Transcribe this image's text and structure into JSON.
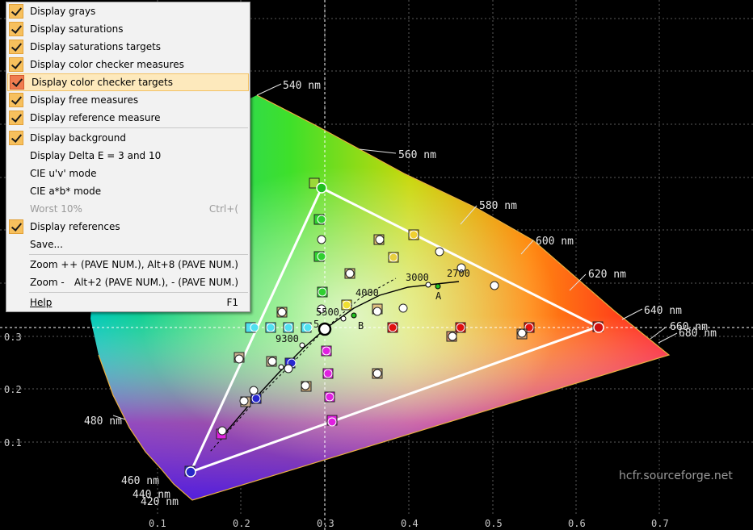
{
  "menu": {
    "items": [
      {
        "label": "Display grays",
        "checked": true,
        "selected": false
      },
      {
        "label": "Display saturations",
        "checked": true,
        "selected": false
      },
      {
        "label": "Display saturations targets",
        "checked": true,
        "selected": false
      },
      {
        "label": "Display color checker measures",
        "checked": true,
        "selected": false
      },
      {
        "label": "Display color checker targets",
        "checked": true,
        "selected": true
      },
      {
        "label": "Display free measures",
        "checked": true,
        "selected": false
      },
      {
        "label": "Display reference measure",
        "checked": true,
        "selected": false
      },
      {
        "label": "Display background",
        "checked": true,
        "selected": false
      },
      {
        "label": "Display Delta E = 3 and 10",
        "checked": false,
        "selected": false
      },
      {
        "label": "CIE u'v' mode",
        "checked": false,
        "selected": false
      },
      {
        "label": "CIE a*b* mode",
        "checked": false,
        "selected": false
      },
      {
        "label": "Worst 10%",
        "shortcut": "Ctrl+(",
        "checked": false,
        "disabled": true
      },
      {
        "label": "Display references",
        "checked": true,
        "selected": false
      },
      {
        "label": "Save...",
        "checked": false,
        "selected": false
      },
      {
        "label": "Zoom +",
        "shortcut": "+ (PAVE NUM.), Alt+8 (PAVE NUM.)",
        "checked": false
      },
      {
        "label": "Zoom -",
        "shortcut": "Alt+2 (PAVE NUM.), - (PAVE NUM.)",
        "checked": false
      },
      {
        "label": "Help",
        "shortcut": "F1",
        "checked": false
      }
    ]
  },
  "axes": {
    "x_ticks": [
      "0.1",
      "0.2",
      "0.3",
      "0.4",
      "0.5",
      "0.6",
      "0.7"
    ],
    "y_ticks": [
      "0.1",
      "0.2",
      "0.3"
    ]
  },
  "wavelengths": [
    "540 nm",
    "560 nm",
    "580 nm",
    "600 nm",
    "620 nm",
    "640 nm",
    "660 nm",
    "680 nm",
    "480 nm",
    "460 nm",
    "440 nm",
    "420 nm"
  ],
  "cct_labels": [
    "3000",
    "2700",
    "4000",
    "5500",
    "9300"
  ],
  "cct_markers": [
    "A",
    "B"
  ],
  "partial_label": "5",
  "watermark": "hcfr.sourceforge.net",
  "colors": {
    "menu_bg": "#f2f2f2",
    "menu_highlight": "#fde9bc",
    "check": "#f7c05d",
    "axis_text": "#c8c8c8"
  },
  "chart_data": {
    "type": "scatter",
    "title": "",
    "xlim": [
      0.0,
      0.8
    ],
    "ylim": [
      0.0,
      0.35
    ],
    "gamut_reference": [
      [
        0.3,
        0.6
      ],
      [
        0.64,
        0.33
      ],
      [
        0.15,
        0.06
      ]
    ],
    "gamut_measured": [
      [
        0.295,
        0.59
      ],
      [
        0.63,
        0.33
      ],
      [
        0.145,
        0.055
      ]
    ],
    "whitepoint": [
      0.3127,
      0.329
    ],
    "blackbody_locus": [
      [
        0.437,
        0.404
      ],
      [
        0.38,
        0.377
      ],
      [
        0.333,
        0.342
      ],
      [
        0.313,
        0.329
      ],
      [
        0.283,
        0.297
      ]
    ]
  }
}
